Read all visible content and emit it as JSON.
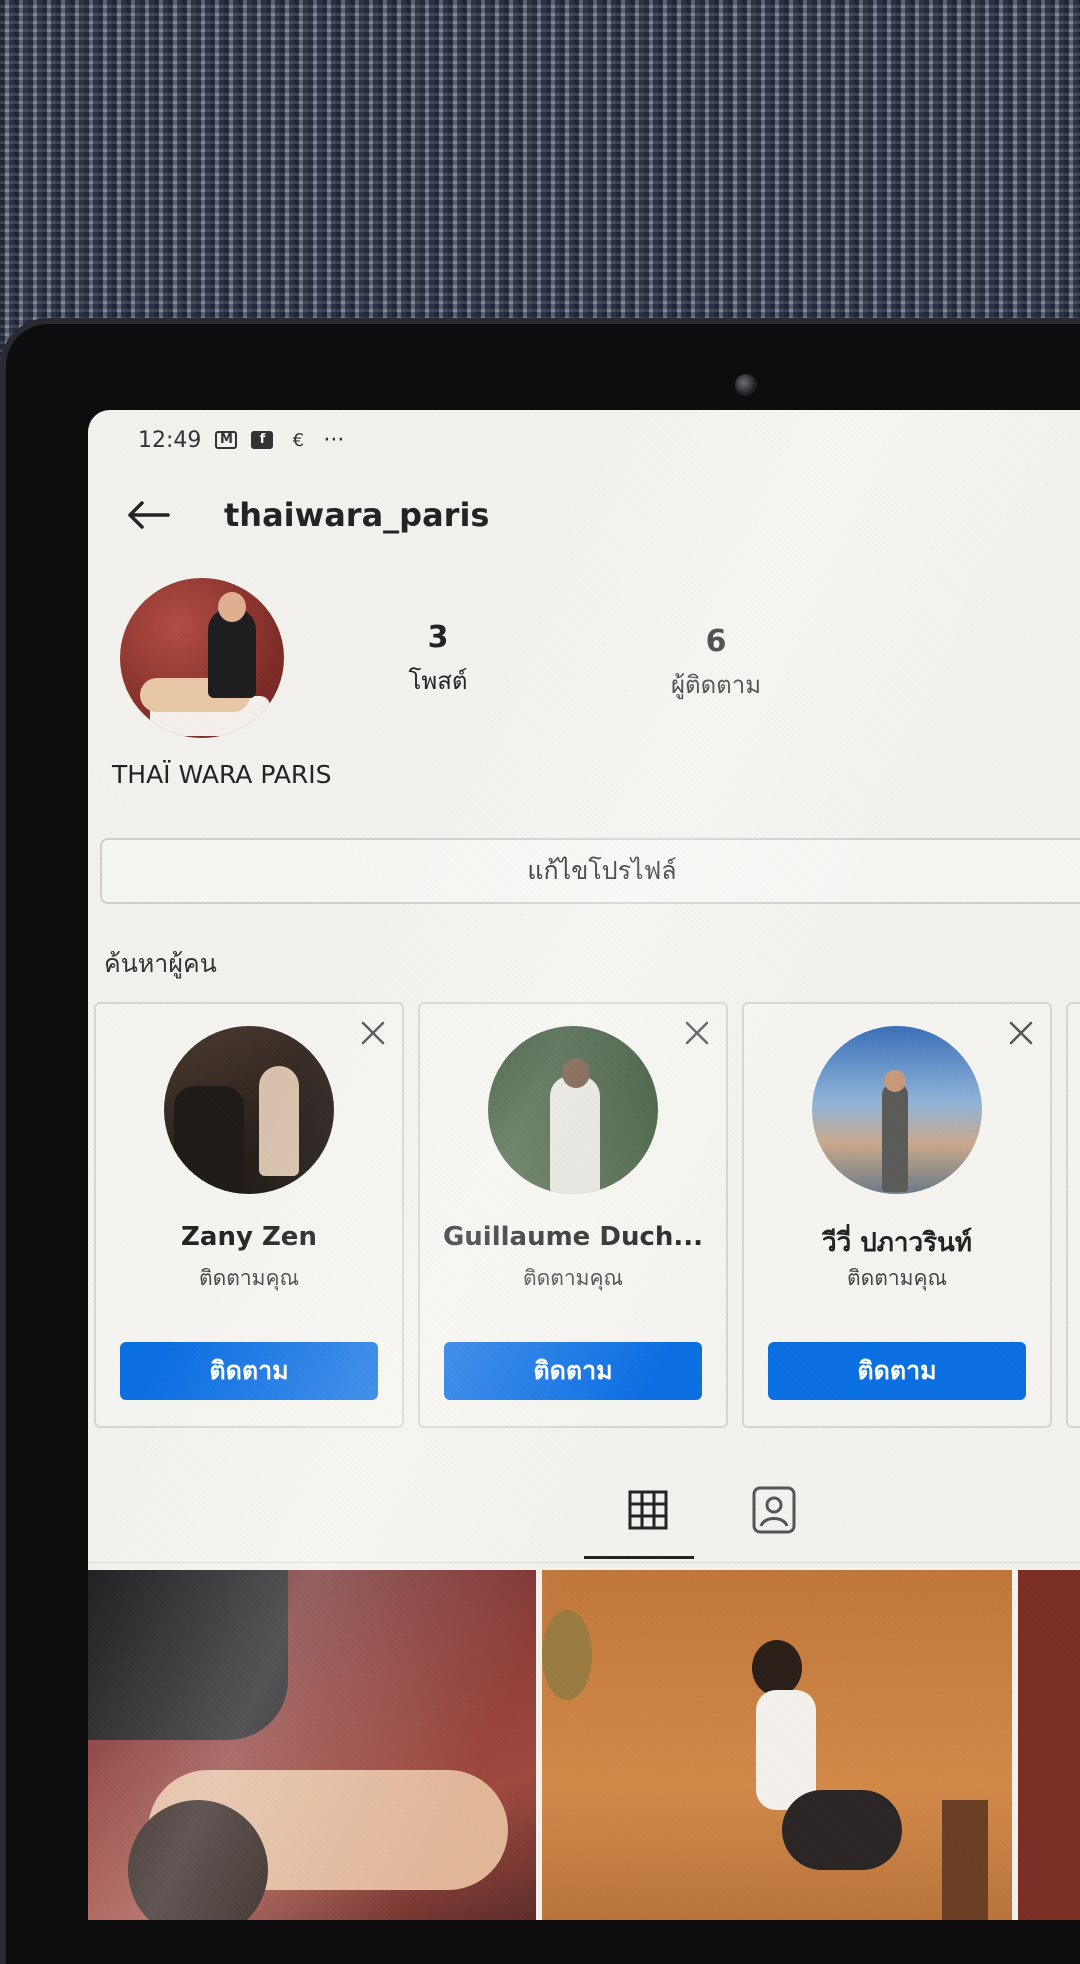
{
  "status_bar": {
    "time": "12:49",
    "icons": [
      "gmail-icon",
      "facebook-icon",
      "currency-icon"
    ],
    "more": "···"
  },
  "header": {
    "username": "thaiwara_paris"
  },
  "profile": {
    "display_name": "THAÏ WARA PARIS",
    "stats": [
      {
        "value": "3",
        "label": "โพสต์"
      },
      {
        "value": "6",
        "label": "ผู้ติดตาม"
      }
    ],
    "edit_button": "แก้ไขโปรไฟล์"
  },
  "suggestions": {
    "title": "ค้นหาผู้คน",
    "cards": [
      {
        "name": "Zany Zen",
        "subtitle": "ติดตามคุณ",
        "button": "ติดตาม"
      },
      {
        "name": "Guillaume Duch...",
        "subtitle": "ติดตามคุณ",
        "button": "ติดตาม"
      },
      {
        "name": "วีวี่ ปภาวรินท์",
        "subtitle": "ติดตามคุณ",
        "button": "ติดตาม"
      }
    ]
  },
  "colors": {
    "accent": "#0a6ee3",
    "screen_bg": "#f3f2ee"
  }
}
